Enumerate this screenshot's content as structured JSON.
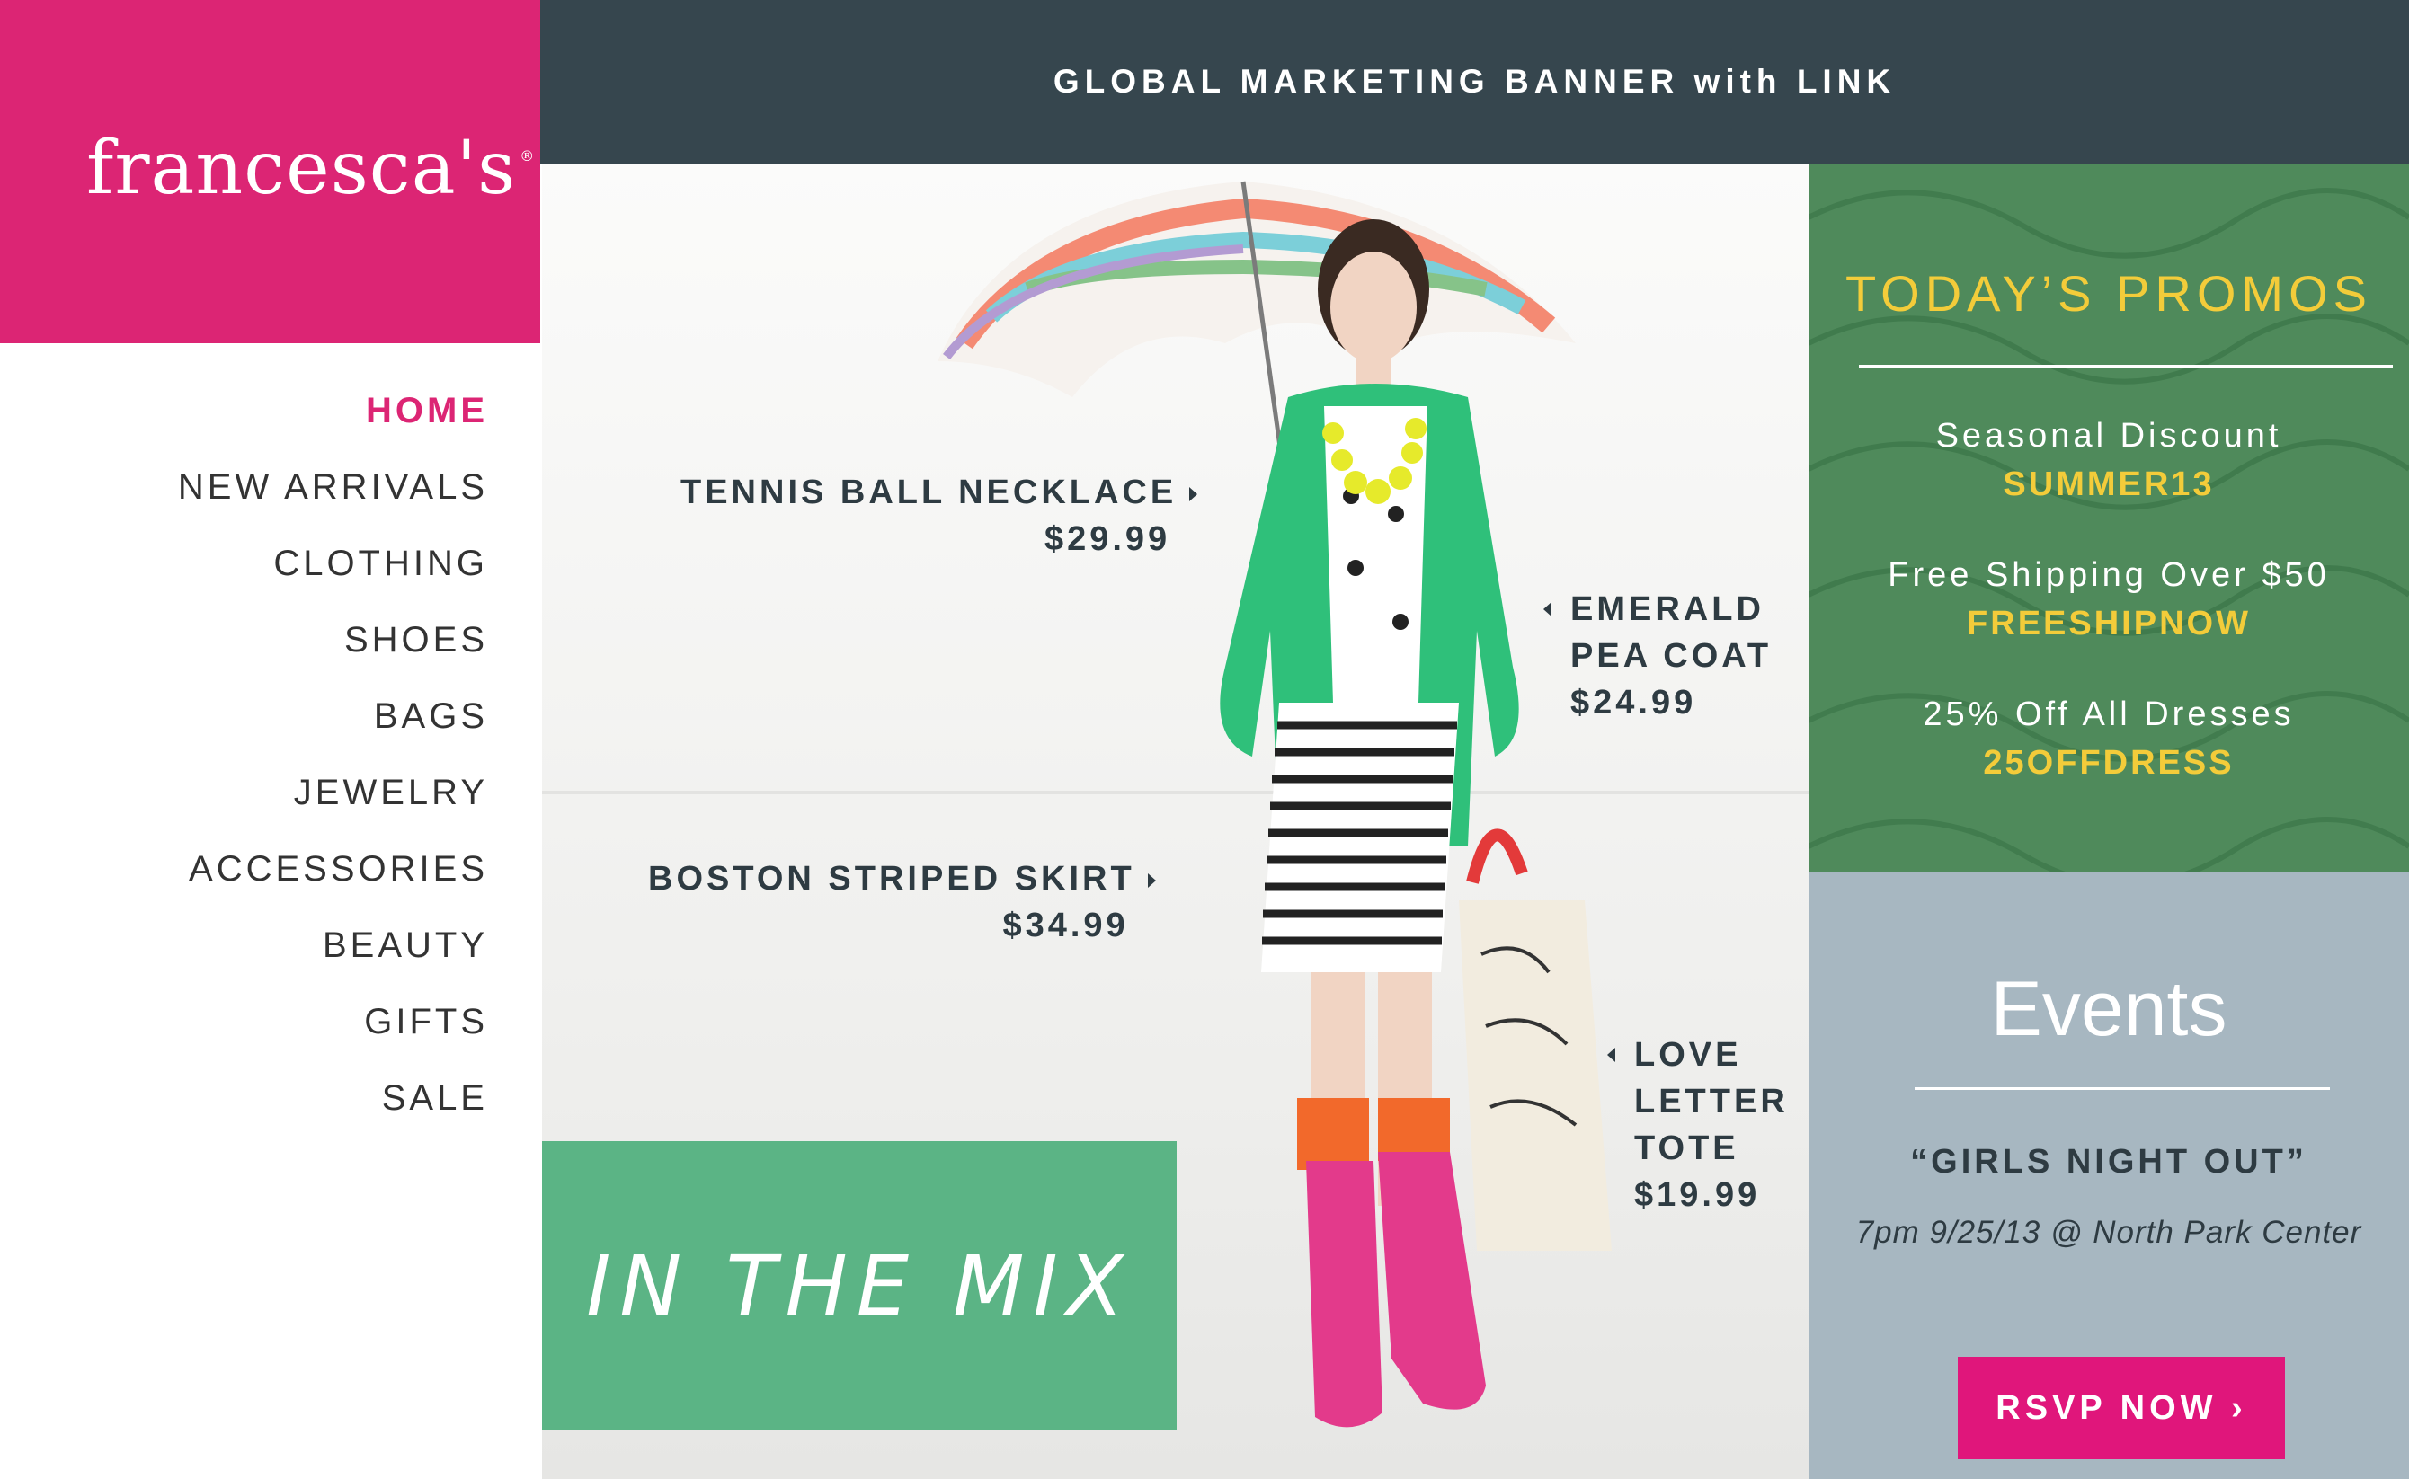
{
  "brand": {
    "logo_text": "francesca's",
    "logo_mark": "®",
    "accent": "#dc2574"
  },
  "nav": {
    "items": [
      "HOME",
      "NEW ARRIVALS",
      "CLOTHING",
      "SHOES",
      "BAGS",
      "JEWELRY",
      "ACCESSORIES",
      "BEAUTY",
      "GIFTS",
      "SALE"
    ],
    "active": "HOME"
  },
  "banner": {
    "text": "GLOBAL MARKETING BANNER with LINK",
    "bg": "#36464e"
  },
  "hero": {
    "feature_label": "IN THE MIX",
    "products": [
      {
        "name": "TENNIS BALL NECKLACE",
        "price": "$29.99"
      },
      {
        "name_lines": [
          "EMERALD",
          "PEA COAT"
        ],
        "price": "$24.99"
      },
      {
        "name": "BOSTON STRIPED SKIRT",
        "price": "$34.99"
      },
      {
        "name_lines": [
          "LOVE",
          "LETTER",
          "TOTE"
        ],
        "price": "$19.99"
      }
    ]
  },
  "promos": {
    "title": "TODAY’S PROMOS",
    "items": [
      {
        "label": "Seasonal Discount",
        "code": "SUMMER13"
      },
      {
        "label": "Free Shipping Over $50",
        "code": "FREESHIPNOW"
      },
      {
        "label": "25% Off All Dresses",
        "code": "25OFFDRESS"
      }
    ],
    "title_color": "#f3cc3a",
    "bg": "#4f8a5b"
  },
  "events": {
    "title": "Events",
    "name": "“GIRLS NIGHT OUT”",
    "detail": "7pm 9/25/13 @ North Park Center",
    "rsvp_label": "RSVP NOW ›",
    "button_color": "#e0167b"
  }
}
